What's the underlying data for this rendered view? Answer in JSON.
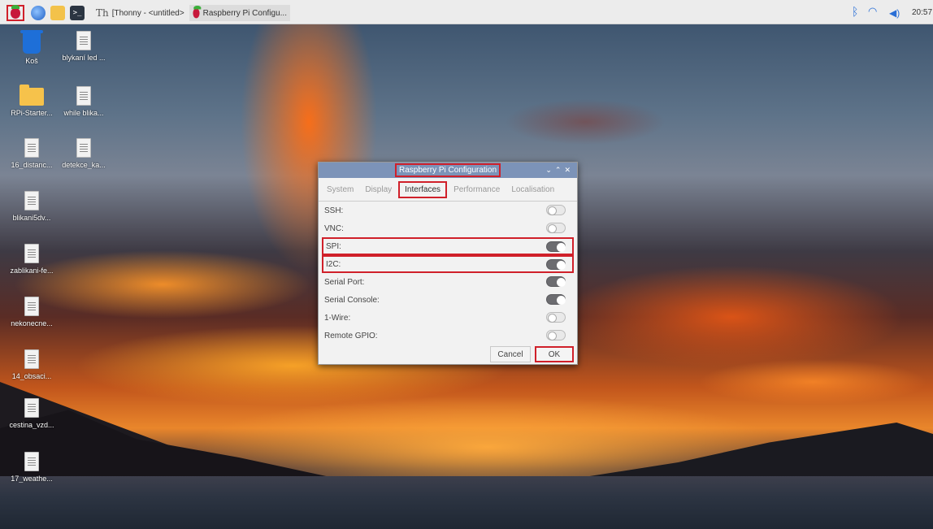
{
  "taskbar": {
    "thonny_task": "[Thonny - <untitled> ...",
    "config_task": "Raspberry Pi Configu...",
    "clock": "20:57"
  },
  "desktop_icons": [
    {
      "label": "Koš",
      "icon": "trash-icon"
    },
    {
      "label": "blykaní led ...",
      "icon": "document-icon"
    },
    {
      "label": "RPi-Starter...",
      "icon": "folder-icon"
    },
    {
      "label": "while blika...",
      "icon": "document-icon"
    },
    {
      "label": "16_distanc...",
      "icon": "document-icon"
    },
    {
      "label": "detekce_ka...",
      "icon": "document-icon"
    },
    {
      "label": "blikani5dv...",
      "icon": "document-icon"
    },
    {
      "label": "zablikani-fe...",
      "icon": "document-icon"
    },
    {
      "label": "nekonecne...",
      "icon": "document-icon"
    },
    {
      "label": "14_obsaci...",
      "icon": "document-icon"
    },
    {
      "label": "cestina_vzd...",
      "icon": "document-icon"
    },
    {
      "label": "17_weathe...",
      "icon": "document-icon"
    }
  ],
  "dialog": {
    "title": "Raspberry Pi Configuration",
    "tabs": [
      "System",
      "Display",
      "Interfaces",
      "Performance",
      "Localisation"
    ],
    "active_tab": "Interfaces",
    "rows": [
      {
        "label": "SSH:",
        "enabled": false
      },
      {
        "label": "VNC:",
        "enabled": false
      },
      {
        "label": "SPI:",
        "enabled": true
      },
      {
        "label": "I2C:",
        "enabled": true
      },
      {
        "label": "Serial Port:",
        "enabled": true
      },
      {
        "label": "Serial Console:",
        "enabled": true
      },
      {
        "label": "1-Wire:",
        "enabled": false
      },
      {
        "label": "Remote GPIO:",
        "enabled": false
      }
    ],
    "cancel_label": "Cancel",
    "ok_label": "OK"
  },
  "colors": {
    "highlight": "#d0202a",
    "titlebar": "#7c93b8"
  }
}
